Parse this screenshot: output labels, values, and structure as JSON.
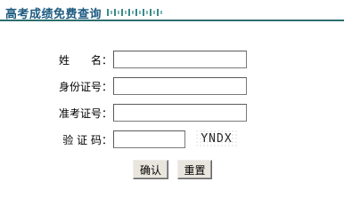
{
  "header": {
    "title": "高考成绩免费查询"
  },
  "form": {
    "name_label": "姓　　名：",
    "id_label": "身份证号：",
    "exam_label": "准考证号：",
    "code_label": "验 证 码：",
    "name_value": "",
    "id_value": "",
    "exam_value": "",
    "code_value": "",
    "captcha_text": "YNDX"
  },
  "buttons": {
    "confirm": "确认",
    "reset": "重置"
  }
}
